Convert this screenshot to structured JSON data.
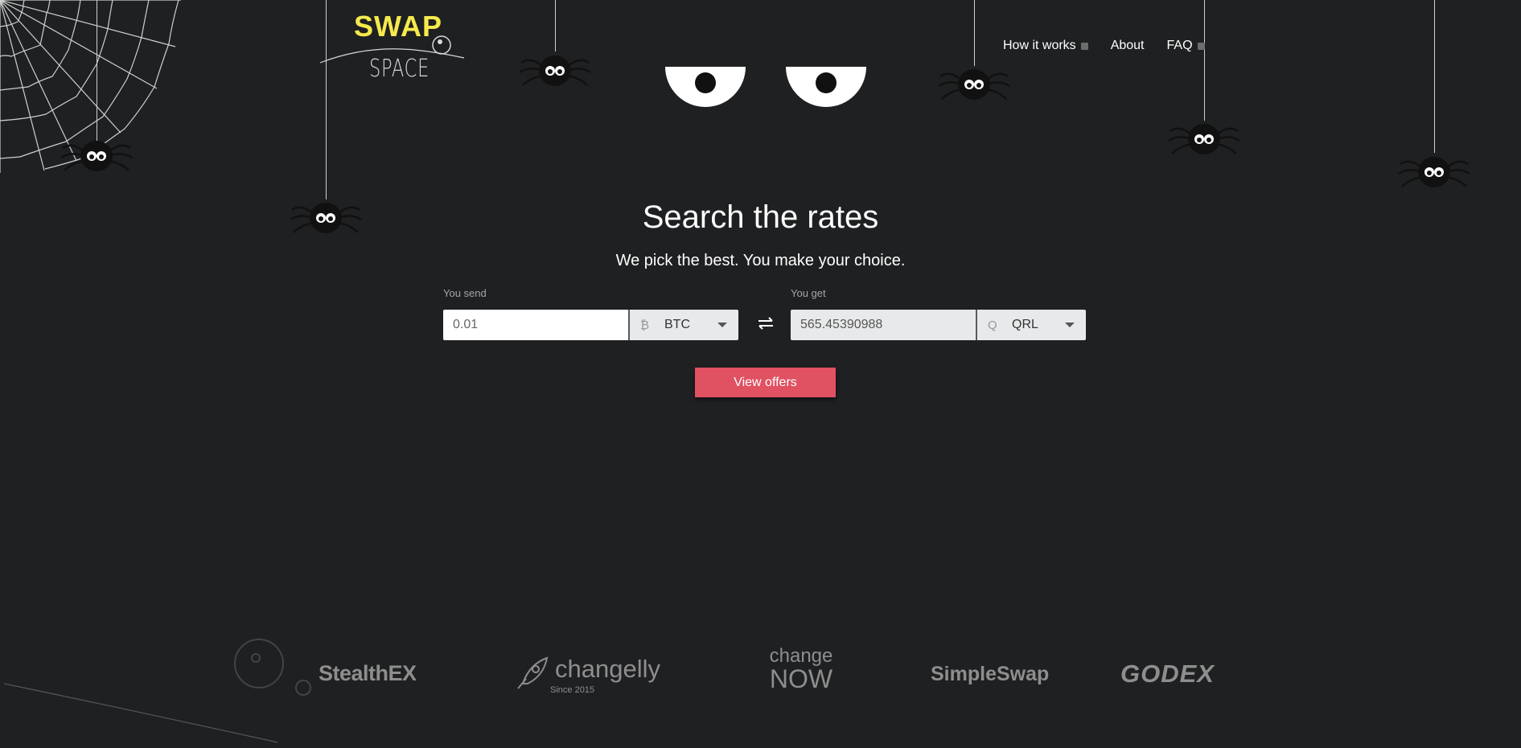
{
  "logo": {
    "top": "SWAP",
    "bottom": "SPACE"
  },
  "nav": {
    "how_it_works": "How it works",
    "about": "About",
    "faq": "FAQ"
  },
  "hero": {
    "title": "Search the rates",
    "subtitle": "We pick the best. You make your choice."
  },
  "form": {
    "send_label": "You send",
    "send_amount": "0.01",
    "send_currency": "BTC",
    "send_currency_icon": "bitcoin-icon",
    "get_label": "You get",
    "get_amount": "565.45390988",
    "get_currency": "QRL",
    "get_currency_icon": "qrl-icon",
    "submit": "View offers"
  },
  "partners": [
    "StealthEX",
    "changelly",
    "Since 2015",
    "change",
    "NOW",
    "SimpleSwap",
    "GODEX"
  ],
  "colors": {
    "background": "#1f2022",
    "logo_yellow": "#f6ea4c",
    "cta": "#e05162"
  }
}
